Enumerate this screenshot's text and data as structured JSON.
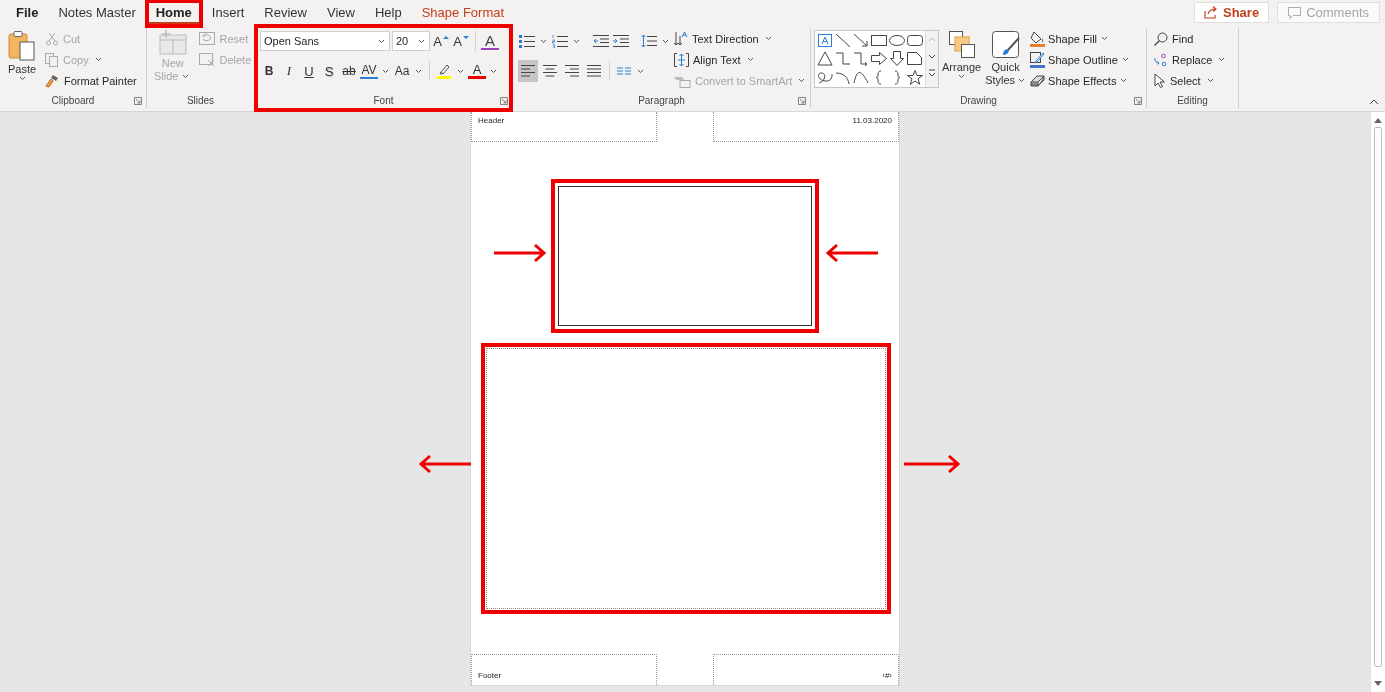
{
  "tabs": [
    {
      "label": "File",
      "kind": "file",
      "selected": false
    },
    {
      "label": "Notes Master",
      "kind": "normal",
      "selected": false
    },
    {
      "label": "Home",
      "kind": "normal",
      "selected": true
    },
    {
      "label": "Insert",
      "kind": "normal",
      "selected": false
    },
    {
      "label": "Review",
      "kind": "normal",
      "selected": false
    },
    {
      "label": "View",
      "kind": "normal",
      "selected": false
    },
    {
      "label": "Help",
      "kind": "normal",
      "selected": false
    },
    {
      "label": "Shape Format",
      "kind": "contextual",
      "selected": false
    }
  ],
  "share": {
    "label": "Share"
  },
  "comments": {
    "label": "Comments",
    "disabled": true
  },
  "clipboard": {
    "label": "Clipboard",
    "paste": "Paste",
    "actions": [
      {
        "label": "Cut",
        "kind": "cut",
        "disabled": true
      },
      {
        "label": "Copy",
        "kind": "copy",
        "disabled": true
      },
      {
        "label": "Format Painter",
        "kind": "painter",
        "disabled": false
      }
    ]
  },
  "slides": {
    "label": "Slides",
    "new_slide": {
      "line1": "New",
      "line2": "Slide",
      "disabled": true
    },
    "actions": [
      {
        "label": "Reset",
        "kind": "reset",
        "disabled": true
      },
      {
        "label": "Delete",
        "kind": "delete",
        "disabled": true
      }
    ]
  },
  "font": {
    "label": "Font",
    "name": "Open Sans",
    "size": "20",
    "size_buttons": [
      {
        "glyph": "A",
        "kind": "grow"
      },
      {
        "glyph": "A",
        "kind": "shrink"
      }
    ],
    "clear_glyph": "A",
    "styles": [
      {
        "glyph": "B",
        "kind": "bold"
      },
      {
        "glyph": "I",
        "kind": "italic"
      },
      {
        "glyph": "U",
        "kind": "underline"
      },
      {
        "glyph": "S",
        "kind": "shadow"
      },
      {
        "glyph": "ab",
        "kind": "strike"
      },
      {
        "glyph": "AV",
        "kind": "spacing"
      },
      {
        "glyph": "Aa",
        "kind": "case"
      }
    ],
    "font_color_glyph": "A"
  },
  "paragraph": {
    "label": "Paragraph",
    "alignments": [
      {
        "kind": "left",
        "selected": true
      },
      {
        "kind": "center",
        "selected": false
      },
      {
        "kind": "right",
        "selected": false
      },
      {
        "kind": "justify",
        "selected": false
      }
    ],
    "commands": [
      {
        "label": "Text Direction",
        "kind": "direction",
        "disabled": false
      },
      {
        "label": "Align Text",
        "kind": "align",
        "disabled": false
      },
      {
        "label": "Convert to SmartArt",
        "kind": "smartart",
        "disabled": true
      }
    ]
  },
  "drawing": {
    "label": "Drawing",
    "arrange": "Arrange",
    "quick_styles": {
      "line1": "Quick",
      "line2": "Styles"
    },
    "commands": [
      {
        "label": "Shape Fill",
        "kind": "fill"
      },
      {
        "label": "Shape Outline",
        "kind": "outline"
      },
      {
        "label": "Shape Effects",
        "kind": "effects"
      }
    ]
  },
  "editing": {
    "label": "Editing",
    "commands": [
      {
        "label": "Find",
        "kind": "find"
      },
      {
        "label": "Replace",
        "kind": "replace"
      },
      {
        "label": "Select",
        "kind": "select"
      }
    ]
  },
  "notes_page": {
    "header": "Header",
    "date": "11.03.2020",
    "footer": "Footer",
    "page_number": "‹#›"
  }
}
